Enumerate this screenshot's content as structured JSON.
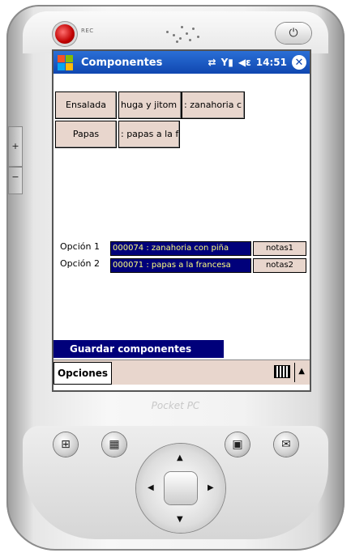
{
  "device": {
    "rec_label": "REC",
    "brand": "Pocket PC",
    "power_icon": "power-icon"
  },
  "titlebar": {
    "title": "Componentes",
    "time": "14:51",
    "icons": [
      "windows-start-icon",
      "sync-icon",
      "signal-icon",
      "volume-icon",
      "close-icon"
    ]
  },
  "components": [
    {
      "label": "Ensalada"
    },
    {
      "label": "huga y jitom"
    },
    {
      "label": ": zanahoria c"
    },
    {
      "label": "Papas"
    },
    {
      "label": ": papas a la f"
    }
  ],
  "options": [
    {
      "label": "Opción 1",
      "value": "000074 : zanahoria con piña",
      "notes": "notas1"
    },
    {
      "label": "Opción 2",
      "value": "000071 : papas a la francesa",
      "notes": "notas2"
    }
  ],
  "save_button": "Guardar componentes",
  "menu": {
    "opciones": "Opciones"
  },
  "colors": {
    "title_blue": "#1047b0",
    "field_bg": "#00007a",
    "field_text": "#ffff80",
    "button_bg": "#e8d6cd"
  }
}
